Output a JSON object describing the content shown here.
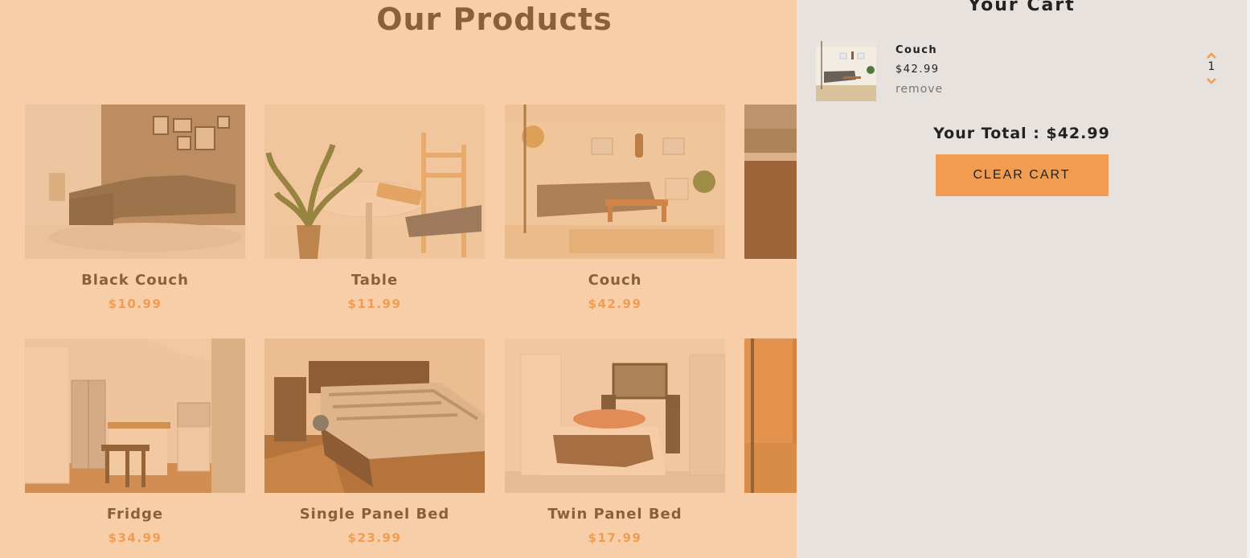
{
  "products": {
    "title": "Our Products",
    "items": [
      {
        "name": "Black Couch",
        "price": "$10.99",
        "image": "black-couch-photo"
      },
      {
        "name": "Table",
        "price": "$11.99",
        "image": "table-photo"
      },
      {
        "name": "Couch",
        "price": "$42.99",
        "image": "couch-photo"
      },
      {
        "name": "",
        "price": "",
        "image": "kitchen-photo"
      },
      {
        "name": "Fridge",
        "price": "$34.99",
        "image": "fridge-photo"
      },
      {
        "name": "Single Panel Bed",
        "price": "$23.99",
        "image": "single-bed-photo"
      },
      {
        "name": "Twin Panel Bed",
        "price": "$17.99",
        "image": "twin-bed-photo"
      },
      {
        "name": "",
        "price": "",
        "image": "room-photo"
      }
    ]
  },
  "cart": {
    "title": "Your Cart",
    "items": [
      {
        "name": "Couch",
        "price": "$42.99",
        "remove_label": "remove",
        "quantity": "1",
        "image": "couch-photo"
      }
    ],
    "total_label": "Your Total : $42.99",
    "clear_label": "clear cart"
  },
  "colors": {
    "accent": "#f09d51",
    "cart_bg": "#e7e2dd",
    "text": "#222222"
  },
  "icons": [
    "chevron-up-icon",
    "chevron-down-icon"
  ]
}
